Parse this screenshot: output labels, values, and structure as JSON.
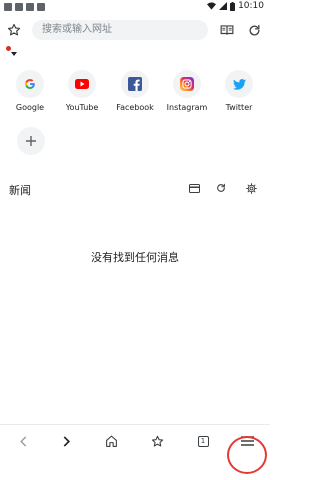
{
  "status_bar": {
    "time": "10:10"
  },
  "toolbar": {
    "url_placeholder": "搜索或输入网址"
  },
  "tiles": [
    {
      "label": "Google",
      "icon": "google-icon"
    },
    {
      "label": "YouTube",
      "icon": "youtube-icon"
    },
    {
      "label": "Facebook",
      "icon": "facebook-icon"
    },
    {
      "label": "Instagram",
      "icon": "instagram-icon"
    },
    {
      "label": "Twitter",
      "icon": "twitter-icon"
    }
  ],
  "news": {
    "title": "新闻",
    "empty_message": "没有找到任何消息"
  },
  "bottom_bar": {
    "tab_count": "1"
  },
  "colors": {
    "accent": "#1a73e8",
    "highlight_ring": "#e53935",
    "notification_dot": "#d93025"
  }
}
